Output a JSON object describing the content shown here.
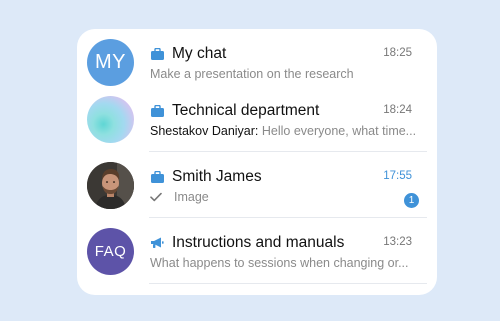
{
  "chats": [
    {
      "avatar_text": "MY",
      "type_icon": "briefcase-icon",
      "name": "My chat",
      "time": "18:25",
      "preview": "Make a presentation on the research"
    },
    {
      "avatar_text": "",
      "type_icon": "briefcase-icon",
      "name": "Technical department",
      "time": "18:24",
      "sender": "Shestakov Daniyar:",
      "preview": " Hello everyone, what time..."
    },
    {
      "avatar_text": "",
      "type_icon": "briefcase-icon",
      "name": "Smith James",
      "time": "17:55",
      "status_icon": "check-icon",
      "preview": "Image",
      "unread_count": "1"
    },
    {
      "avatar_text": "FAQ",
      "type_icon": "megaphone-icon",
      "name": "Instructions and manuals",
      "time": "13:23",
      "preview": "What happens to sessions when changing or..."
    }
  ],
  "colors": {
    "background": "#dde9f8",
    "accent": "#3f92d8",
    "avatar_my": "#5b9ee0",
    "avatar_faq": "#5d53a8"
  }
}
